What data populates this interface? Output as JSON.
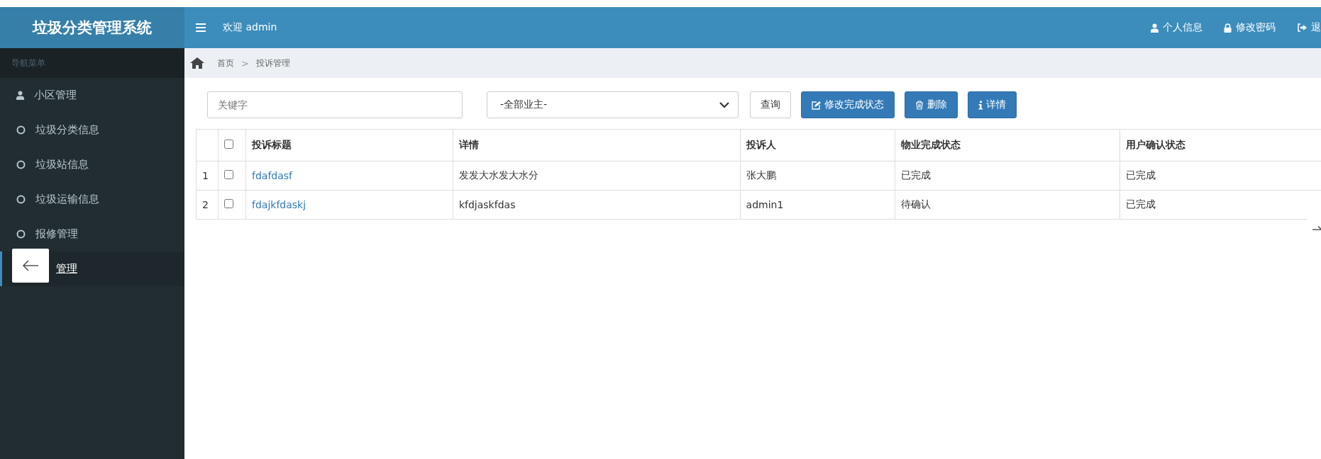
{
  "header": {
    "brand": "垃圾分类管理系统",
    "welcome": "欢迎 admin",
    "links": [
      {
        "kind": "user",
        "label": "个人信息"
      },
      {
        "kind": "lock",
        "label": "修改密码"
      },
      {
        "kind": "logout",
        "label": "退"
      }
    ]
  },
  "sidebar": {
    "heading": "导航菜单",
    "items": [
      {
        "kind": "user",
        "label": "小区管理",
        "selected": false
      },
      {
        "kind": "circle",
        "label": "垃圾分类信息",
        "selected": false
      },
      {
        "kind": "circle",
        "label": "垃圾站信息",
        "selected": false
      },
      {
        "kind": "circle",
        "label": "垃圾运输信息",
        "selected": false
      },
      {
        "kind": "circle",
        "label": "报修管理",
        "selected": false
      },
      {
        "kind": "back",
        "label": "管理",
        "selected": true
      }
    ]
  },
  "breadcrumb": [
    "首页",
    ">",
    "投诉管理"
  ],
  "toolbar": {
    "keyword_placeholder": "关键字",
    "owner_select": "-全部业主-",
    "buttons": [
      {
        "kind": "plain",
        "label": "查询"
      },
      {
        "kind": "edit",
        "label": "修改完成状态"
      },
      {
        "kind": "trash",
        "label": "删除"
      },
      {
        "kind": "info",
        "label": "详情"
      }
    ]
  },
  "table": {
    "header_checked": false,
    "columns": [
      "投诉标题",
      "详情",
      "投诉人",
      "物业完成状态",
      "用户确认状态"
    ],
    "rows": [
      {
        "index": "1",
        "checked": false,
        "cells": [
          "fdafdasf",
          "发发大水发大水分",
          "张大鹏",
          "已完成",
          "已完成"
        ]
      },
      {
        "index": "2",
        "checked": false,
        "cells": [
          "fdajkfdaskj",
          "kfdjaskfdas",
          "admin1",
          "待确认",
          "已完成"
        ]
      }
    ]
  }
}
